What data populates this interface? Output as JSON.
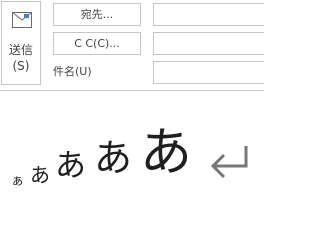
{
  "header": {
    "send": {
      "label_line1": "送信",
      "label_line2": "(S)"
    },
    "to_button": "宛先...",
    "cc_button": "C C(C)...",
    "subject_label": "件名(U)",
    "to_value": "",
    "cc_value": "",
    "subject_value": ""
  },
  "body": {
    "chars": [
      "ぁ",
      "あ",
      "あ",
      "あ",
      "あ",
      "あ"
    ]
  },
  "icons": {
    "send": "send-mail-icon",
    "return": "paragraph-return-icon"
  }
}
